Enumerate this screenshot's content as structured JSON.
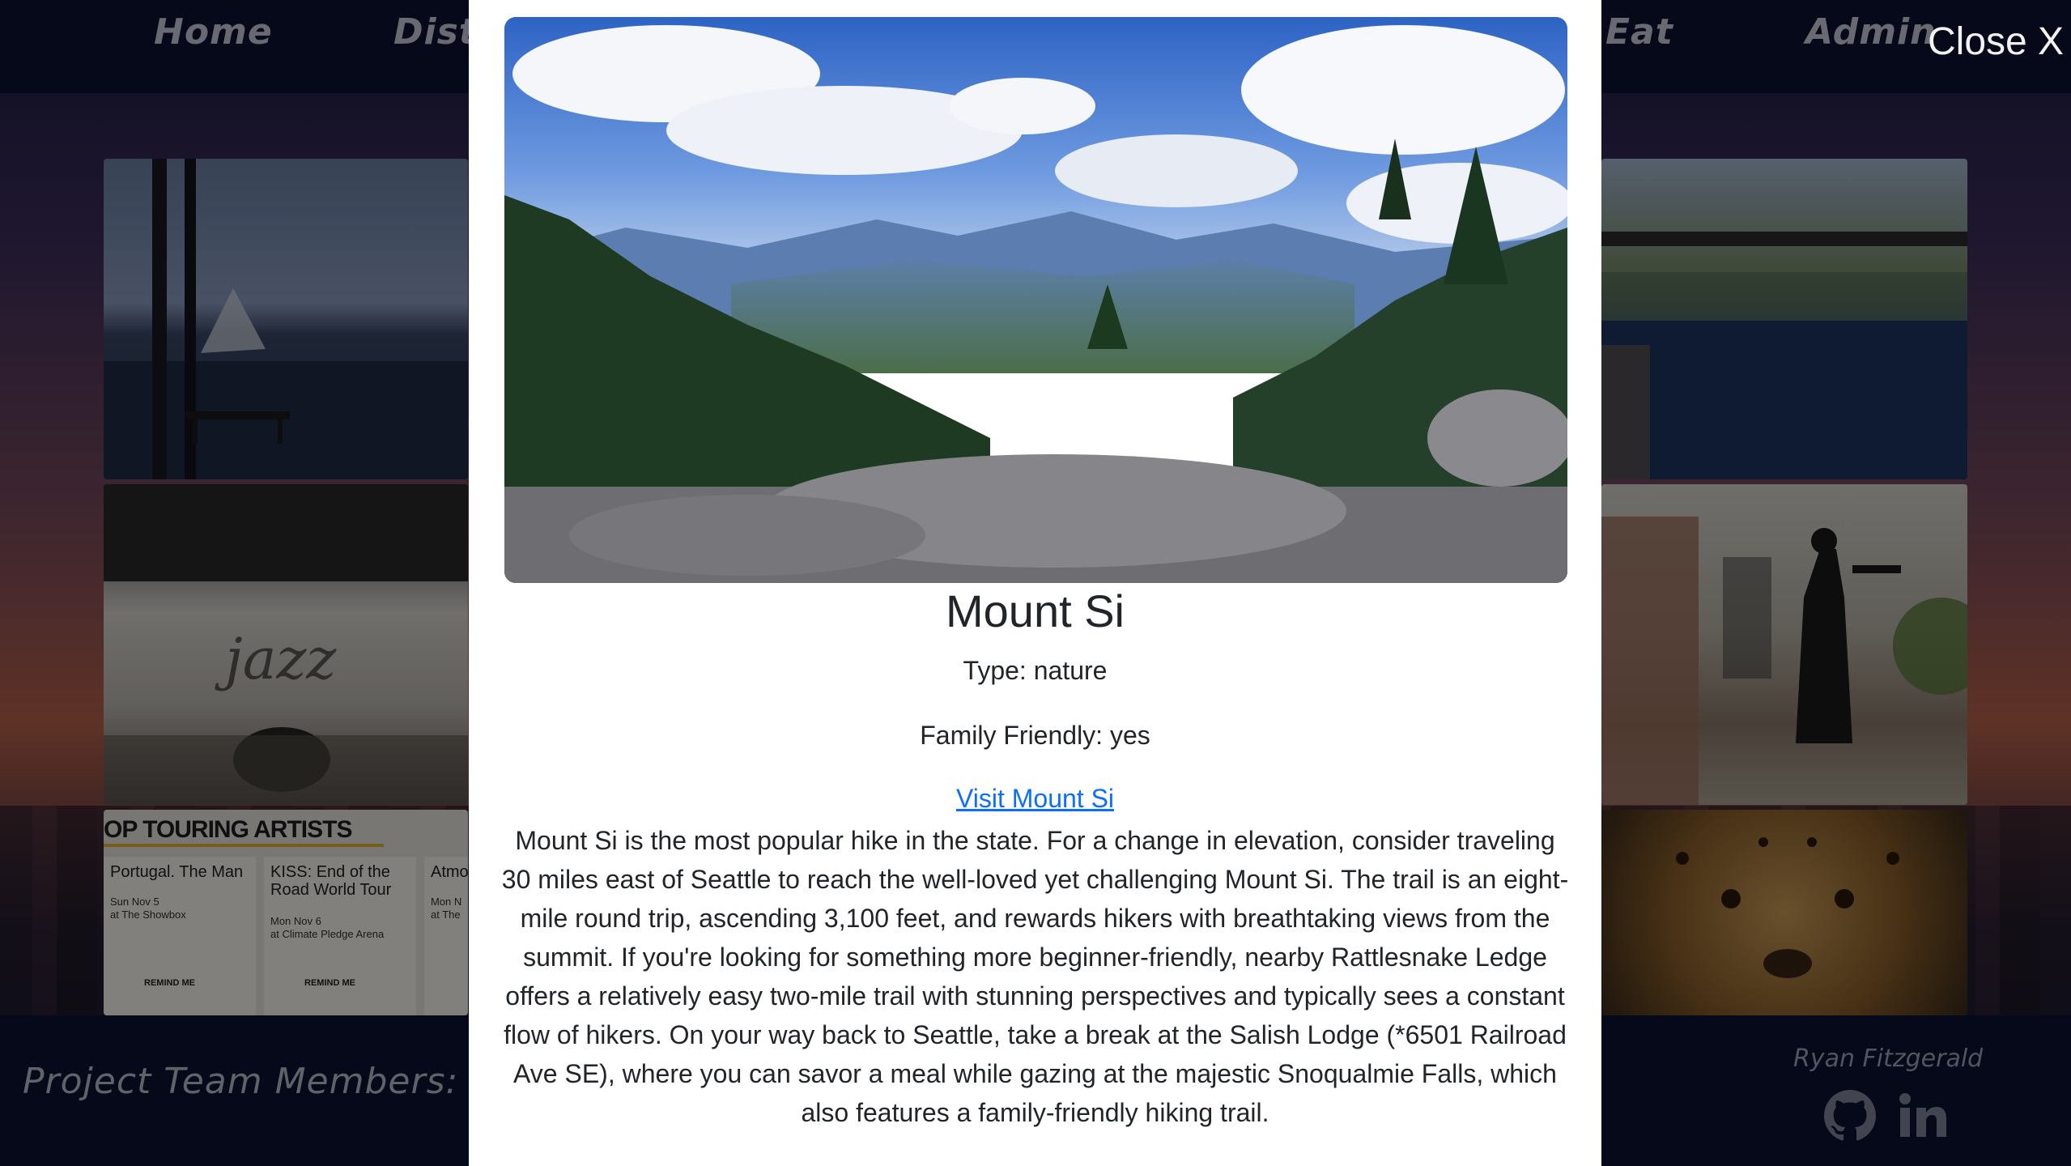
{
  "nav": {
    "items": [
      "Home",
      "Dist",
      "Eat",
      "Admin"
    ]
  },
  "footer": {
    "title": "Project Team Members:",
    "member_name": "Ryan Fitzgerald",
    "icons": [
      "github-icon",
      "linkedin-icon"
    ]
  },
  "background_tiles": {
    "artists": {
      "heading": "OP TOURING ARTISTS",
      "cards": [
        {
          "name": "Portugal. The Man",
          "date": "Sun Nov 5",
          "venue": "at The Showbox",
          "remind": "REMIND ME"
        },
        {
          "name": "KISS: End of the Road World Tour",
          "date": "Mon Nov 6",
          "venue": "at Climate Pledge Arena",
          "remind": "REMIND ME"
        },
        {
          "name": "Atmo",
          "date": "Mon N",
          "venue": "at The",
          "remind": ""
        }
      ]
    }
  },
  "modal": {
    "close_label": "Close X",
    "title": "Mount Si",
    "type_line": "Type: nature",
    "family_line": "Family Friendly: yes",
    "link_text": "Visit Mount Si",
    "description": "Mount Si is the most popular hike in the state. For a change in elevation, consider traveling 30 miles east of Seattle to reach the well-loved yet challenging Mount Si. The trail is an eight-mile round trip, ascending 3,100 feet, and rewards hikers with breathtaking views from the summit. If you're looking for something more beginner-friendly, nearby Rattlesnake Ledge offers a relatively easy two-mile trail with stunning perspectives and typically sees a constant flow of hikers. On your way back to Seattle, take a break at the Salish Lodge (*6501 Railroad Ave SE), where you can savor a meal while gazing at the majestic Snoqualmie Falls, which also features a family-friendly hiking trail."
  },
  "colors": {
    "nav_bg": "#0c1230",
    "link": "#0d6efd",
    "text": "#212529"
  }
}
